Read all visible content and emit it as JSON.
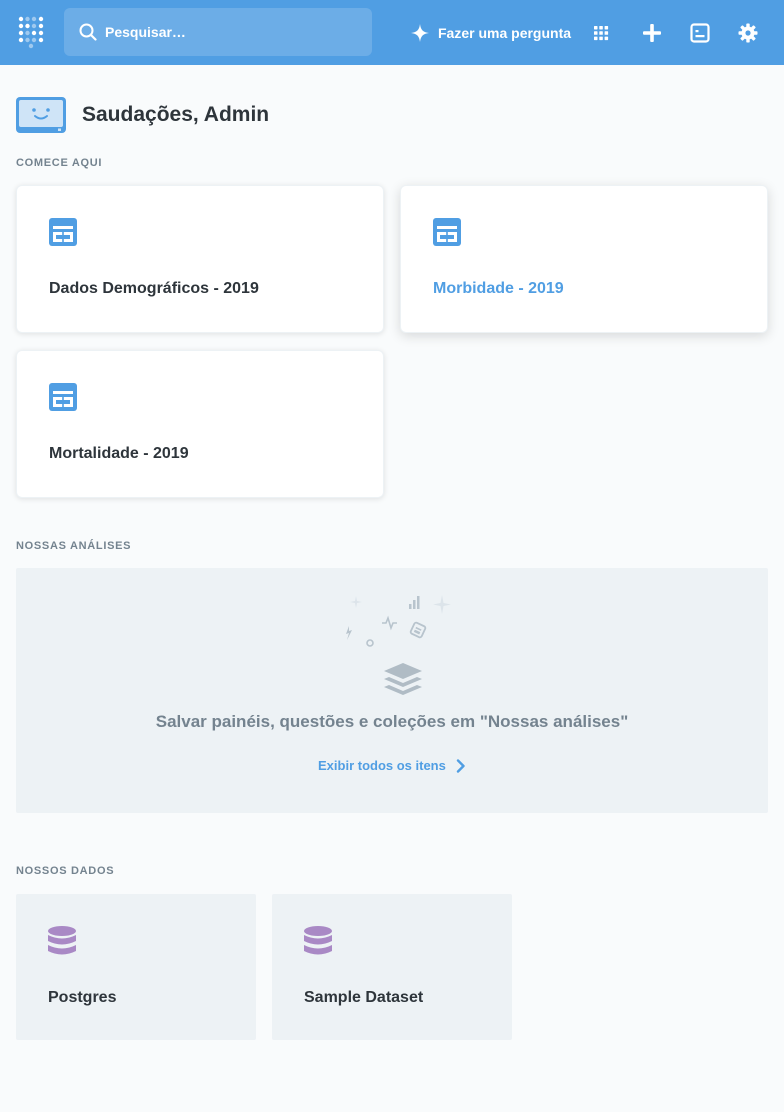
{
  "nav": {
    "search_placeholder": "Pesquisar…",
    "ask_label": "Fazer uma pergunta",
    "icons": [
      "logo-icon",
      "search-icon",
      "sparkle-icon",
      "grid-icon",
      "plus-icon",
      "terminal-icon",
      "gear-icon"
    ]
  },
  "greeting": {
    "text": "Saudações, Admin"
  },
  "start_here": {
    "label": "Comece aqui",
    "items": [
      {
        "title": "Dados Demográficos - 2019",
        "hovered": false
      },
      {
        "title": "Morbidade - 2019",
        "hovered": true
      },
      {
        "title": "Mortalidade - 2019",
        "hovered": false
      }
    ]
  },
  "analytics": {
    "label": "Nossas análises",
    "empty_message": "Salvar painéis, questões e coleções em \"Nossas análises\"",
    "view_all": "Exibir todos os itens"
  },
  "data": {
    "label": "Nossos dados",
    "items": [
      {
        "title": "Postgres"
      },
      {
        "title": "Sample Dataset"
      }
    ]
  },
  "colors": {
    "brand": "#509ee3",
    "text_dark": "#2e353b",
    "text_muted": "#74838f",
    "panel_bg": "#edf2f5",
    "database_purple": "#a989c5"
  }
}
